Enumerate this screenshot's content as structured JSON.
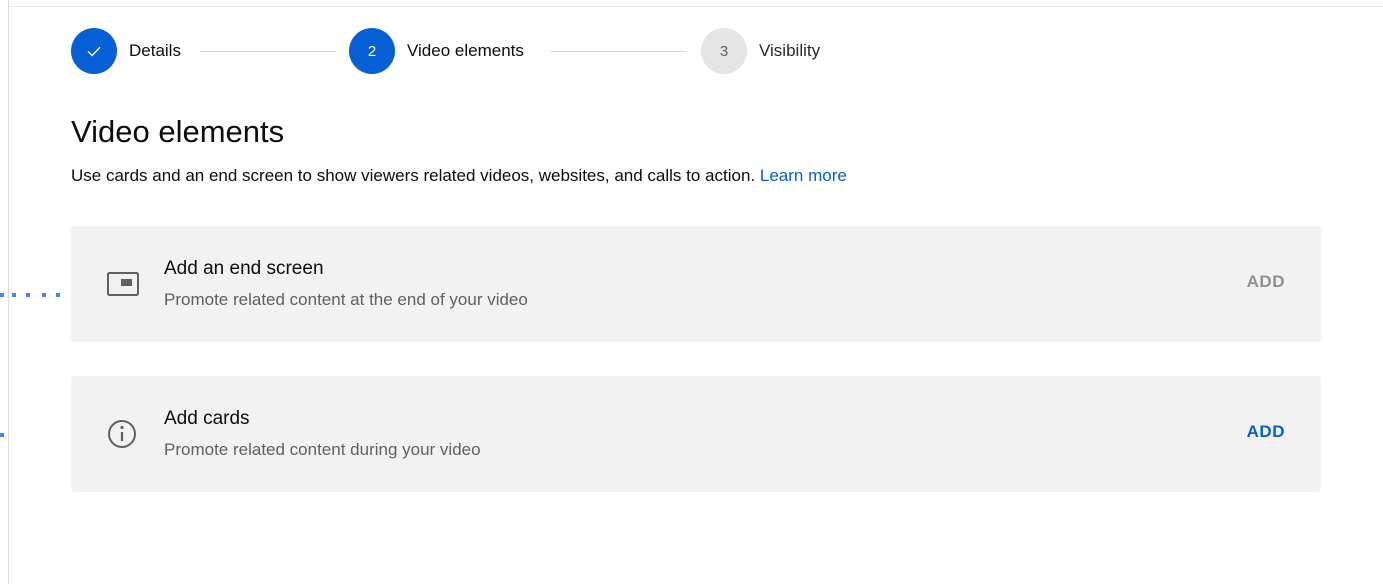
{
  "stepper": {
    "steps": [
      {
        "label": "Details",
        "number": "",
        "state": "complete",
        "icon": "check-icon"
      },
      {
        "label": "Video elements",
        "number": "2",
        "state": "active"
      },
      {
        "label": "Visibility",
        "number": "3",
        "state": "pending"
      }
    ]
  },
  "page": {
    "title": "Video elements",
    "subtitle": "Use cards and an end screen to show viewers related videos, websites, and calls to action.",
    "learn_more": "Learn more"
  },
  "cards": [
    {
      "title": "Add an end screen",
      "description": "Promote related content at the end of your video",
      "action": "ADD",
      "action_state": "disabled",
      "icon": "end-screen-icon"
    },
    {
      "title": "Add cards",
      "description": "Promote related content during your video",
      "action": "ADD",
      "action_state": "enabled",
      "icon": "info-icon"
    }
  ],
  "colors": {
    "accent": "#065fd4",
    "card_bg": "#f2f2f2",
    "secondary_text": "#606060",
    "disabled_text": "#909090",
    "pending_circle": "#e5e5e5"
  }
}
